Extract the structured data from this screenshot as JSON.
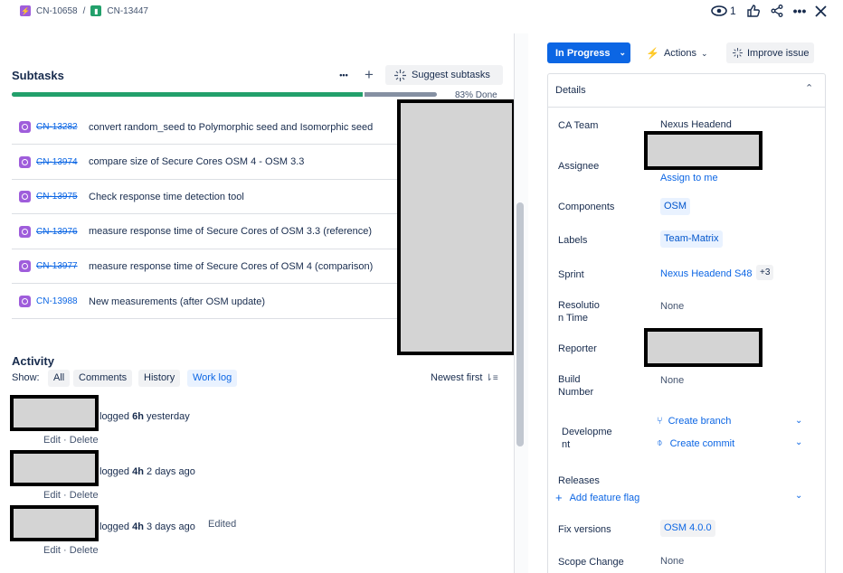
{
  "breadcrumb": {
    "parent_key": "CN-10658",
    "separator": "/",
    "issue_key": "CN-13447"
  },
  "header_icons": {
    "watch_count": "1"
  },
  "subtasks": {
    "title": "Subtasks",
    "suggest_label": "Suggest subtasks",
    "progress_percent": 83,
    "progress_label": "83% Done",
    "items": [
      {
        "key": "CN-13282",
        "done": true,
        "summary": "convert random_seed to Polymorphic seed and Isomorphic seed"
      },
      {
        "key": "CN-13974",
        "done": true,
        "summary": "compare size of Secure Cores OSM 4 - OSM 3.3"
      },
      {
        "key": "CN-13975",
        "done": true,
        "summary": "Check response time detection tool"
      },
      {
        "key": "CN-13976",
        "done": true,
        "summary": "measure response time of Secure Cores of OSM 3.3 (reference)"
      },
      {
        "key": "CN-13977",
        "done": true,
        "summary": "measure response time of Secure Cores of OSM 4 (comparison)"
      },
      {
        "key": "CN-13988",
        "done": false,
        "summary": "New measurements (after OSM update)"
      }
    ]
  },
  "activity": {
    "title": "Activity",
    "show_label": "Show:",
    "filters": [
      "All",
      "Comments",
      "History",
      "Work log"
    ],
    "sort_label": "Newest first",
    "entries": [
      {
        "verb": "logged",
        "duration": "6h",
        "when": "yesterday",
        "edited": "",
        "edit": "Edit",
        "sep": "·",
        "delete": "Delete"
      },
      {
        "verb": "logged",
        "duration": "4h",
        "when": "2 days ago",
        "edited": "",
        "edit": "Edit",
        "sep": "·",
        "delete": "Delete"
      },
      {
        "verb": "logged",
        "duration": "4h",
        "when": "3 days ago",
        "edited": "Edited",
        "edit": "Edit",
        "sep": "·",
        "delete": "Delete"
      }
    ]
  },
  "right": {
    "status_label": "In Progress",
    "actions_label": "Actions",
    "improve_label": "Improve issue",
    "details_title": "Details",
    "fields": {
      "ca_team": {
        "label": "CA Team",
        "value": "Nexus Headend"
      },
      "assignee": {
        "label": "Assignee",
        "link": "Assign to me"
      },
      "components": {
        "label": "Components",
        "value": "OSM"
      },
      "labels": {
        "label": "Labels",
        "value": "Team-Matrix"
      },
      "sprint": {
        "label": "Sprint",
        "value": "Nexus Headend S48",
        "extra": "+3"
      },
      "resolution_time": {
        "label_1": "Resolutio",
        "label_2": "n Time",
        "value": "None"
      },
      "reporter": {
        "label": "Reporter"
      },
      "build_number": {
        "label_1": "Build",
        "label_2": "Number",
        "value": "None"
      },
      "development": {
        "label_1": "Developme",
        "label_2": "nt",
        "create_branch": "Create branch",
        "create_commit": "Create commit"
      },
      "releases": {
        "label": "Releases",
        "add_flag": "Add feature flag"
      },
      "fix_versions": {
        "label": "Fix versions",
        "value": "OSM 4.0.0"
      },
      "scope_change": {
        "label": "Scope Change",
        "value": "None"
      }
    }
  },
  "colors": {
    "primary": "#0c66e4",
    "progress_done": "#22a06b",
    "progress_rest": "#8590a2",
    "subtask_icon": "#9f5ddb"
  }
}
